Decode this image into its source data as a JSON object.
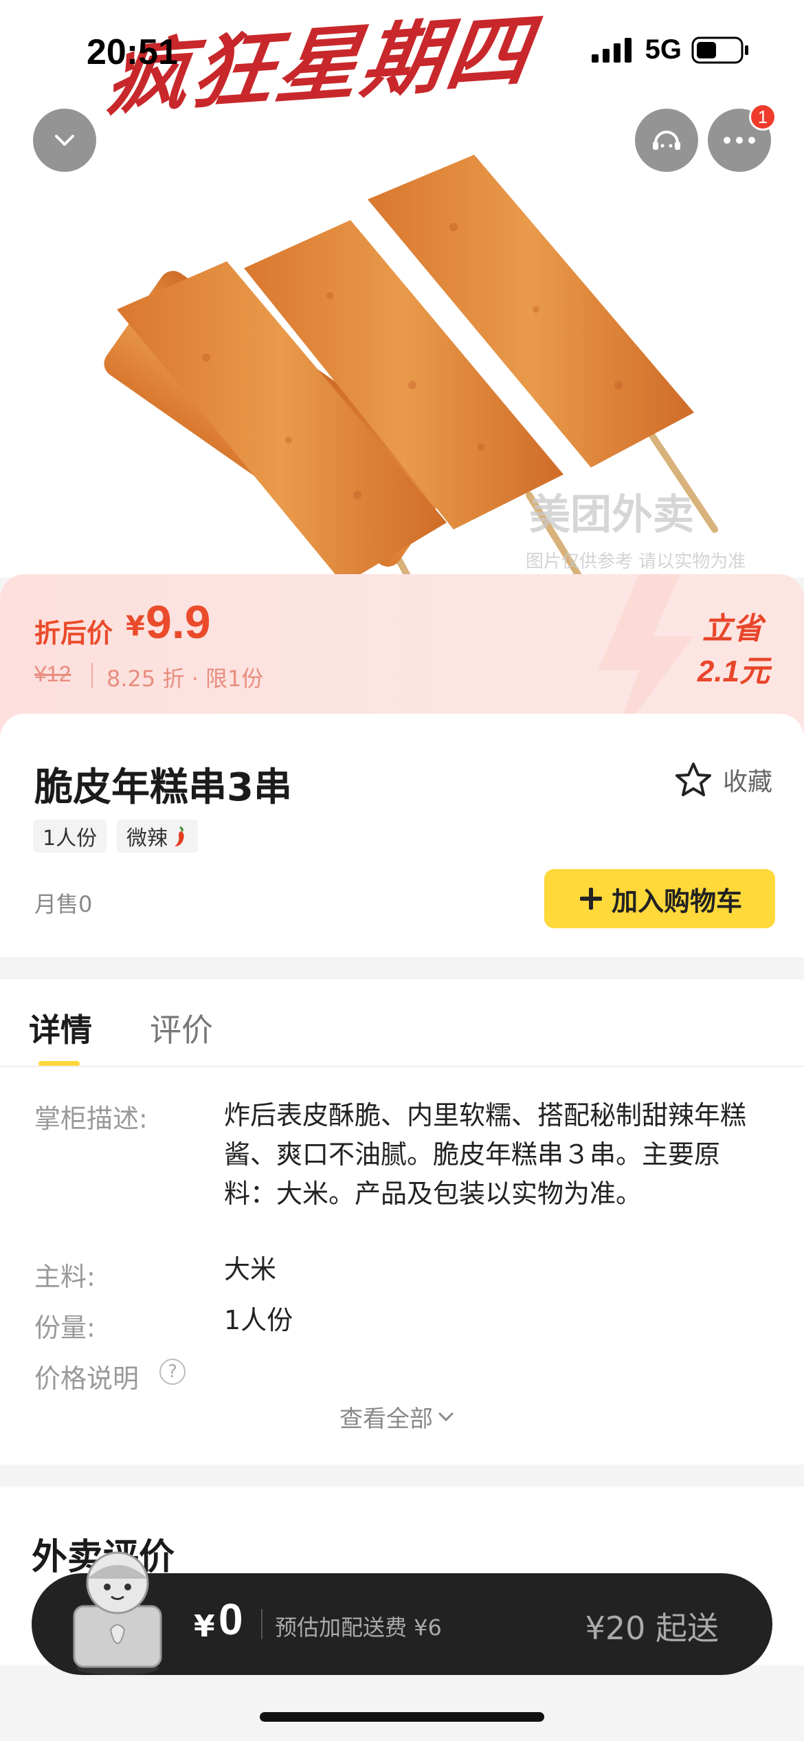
{
  "status_bar": {
    "time": "20:51",
    "network": "5G"
  },
  "hero": {
    "slogan": "疯狂星期四",
    "watermark": "美团外卖",
    "watermark_note": "图片仅供参考 请以实物为准",
    "menu_badge": "1",
    "icons": [
      "chevron-down-icon",
      "customer-service-icon",
      "more-icon"
    ]
  },
  "promo": {
    "label": "折后价",
    "currency": "¥",
    "price": "9.9",
    "original_price": "¥12",
    "discount_info": "8.25 折 · 限1份",
    "save_label": "立省",
    "save_amount": "2.1元"
  },
  "product": {
    "name": "脆皮年糕串3串",
    "favorite_label": "收藏",
    "tags": [
      "1人份",
      "微辣"
    ],
    "monthly_sales": "月售0",
    "add_to_cart": "加入购物车"
  },
  "detail": {
    "tabs": [
      "详情",
      "评价"
    ],
    "rows": [
      {
        "label": "掌柜描述:",
        "value": "炸后表皮酥脆、内里软糯、搭配秘制甜辣年糕酱、爽口不油腻。脆皮年糕串３串。主要原料：大米。产品及包装以实物为准。"
      },
      {
        "label": "主料:",
        "value": "大米"
      },
      {
        "label": "份量:",
        "value": "1人份"
      },
      {
        "label": "价格说明",
        "value": ""
      }
    ],
    "view_all": "查看全部"
  },
  "reviews": {
    "title": "外卖评价"
  },
  "bottom_bar": {
    "currency": "¥",
    "total": "0",
    "delivery_fee": "预估加配送费 ¥6",
    "min_order": "¥20 起送"
  },
  "colors": {
    "accent": "#ea4b2b",
    "cart_yellow": "#ffd83a",
    "bar_dark": "#222222"
  }
}
